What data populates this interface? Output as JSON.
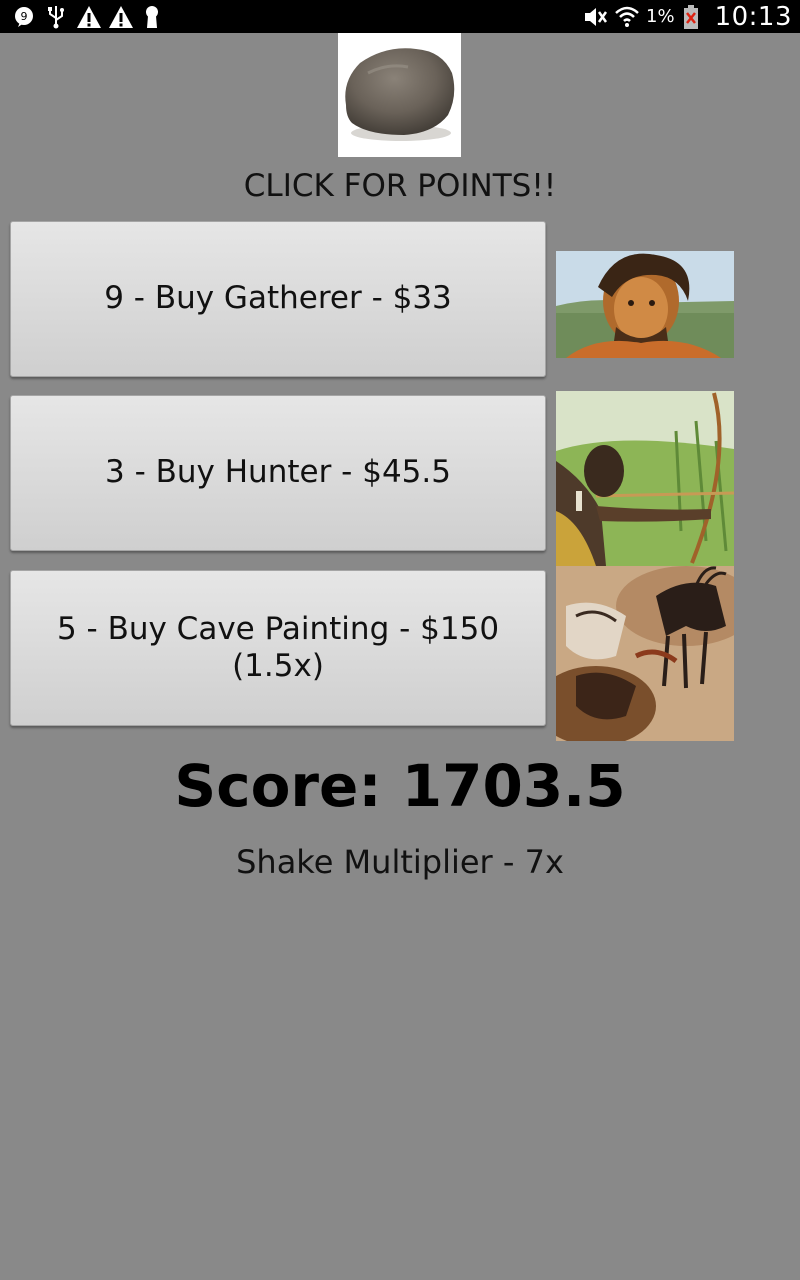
{
  "status_bar": {
    "battery_percent": "1%",
    "time": "10:13",
    "icons": [
      "chat-icon",
      "usb-icon",
      "warning-icon",
      "warning-icon",
      "keyhole-icon",
      "mute-icon",
      "wifi-icon",
      "battery-low-icon"
    ]
  },
  "header": {
    "rock_icon": "rock-icon",
    "headline": "CLICK FOR POINTS!!"
  },
  "shop": {
    "items": [
      {
        "label": "9 - Buy Gatherer - $33",
        "image": "gatherer-image"
      },
      {
        "label": "3 - Buy Hunter - $45.5",
        "image": "hunter-image"
      },
      {
        "label": "5 - Buy Cave Painting - $150\n(1.5x)",
        "image": "cave-painting-image"
      }
    ]
  },
  "stats": {
    "score": "Score: 1703.5",
    "multiplier": "Shake Multiplier - 7x"
  },
  "colors": {
    "background": "#898989",
    "status_bar": "#000000",
    "button_top": "#e6e6e6",
    "button_bottom": "#cfcfcf"
  }
}
